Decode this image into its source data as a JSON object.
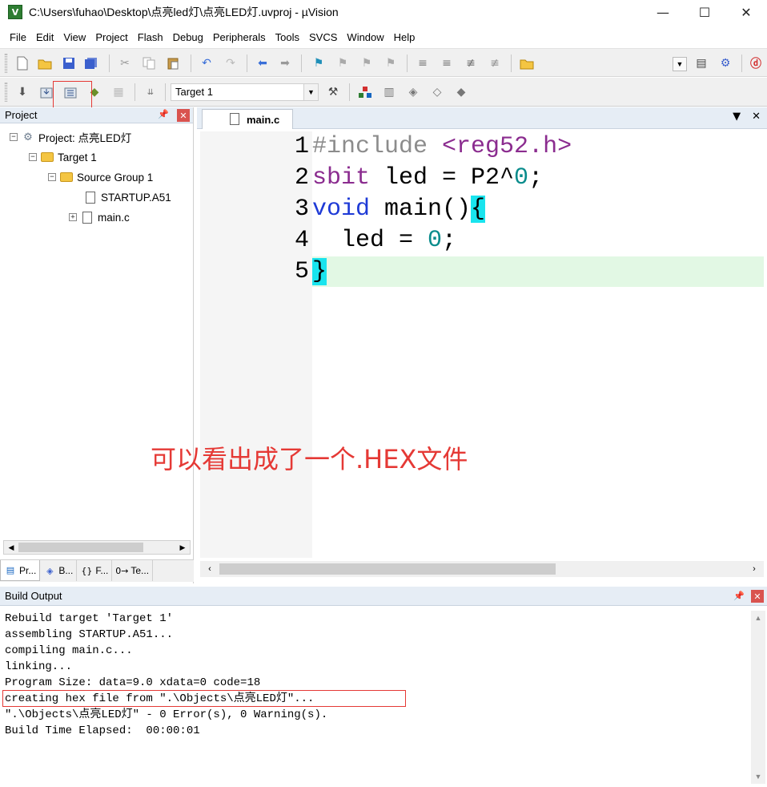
{
  "window": {
    "title": "C:\\Users\\fuhao\\Desktop\\点亮led灯\\点亮LED灯.uvproj - µVision",
    "app_icon_letter": "V",
    "minimize": "—",
    "maximize": "☐",
    "close": "✕"
  },
  "menu": [
    "File",
    "Edit",
    "View",
    "Project",
    "Flash",
    "Debug",
    "Peripherals",
    "Tools",
    "SVCS",
    "Window",
    "Help"
  ],
  "toolbar2": {
    "target": "Target 1"
  },
  "project_panel": {
    "title": "Project",
    "tree": {
      "project": "Project: 点亮LED灯",
      "target": "Target 1",
      "group": "Source Group 1",
      "files": [
        "STARTUP.A51",
        "main.c"
      ]
    },
    "tabs": [
      "Pr...",
      "B...",
      "F...",
      "Te..."
    ]
  },
  "editor": {
    "tab": "main.c",
    "line_numbers": [
      "1",
      "2",
      "3",
      "4",
      "5"
    ],
    "lines": {
      "l1_pp": "#include",
      "l1_str": "<reg52.h>",
      "l2_kw": "sbit",
      "l2_rest": " led = P2^",
      "l2_num": "0",
      "l2_end": ";",
      "l3_kw": "void",
      "l3_rest": " main()",
      "l3_brace": "{",
      "l4_rest": "  led = ",
      "l4_num": "0",
      "l4_end": ";",
      "l5_brace": "}"
    }
  },
  "annotation": "可以看出成了一个.HEX文件",
  "build_output": {
    "title": "Build Output",
    "lines": [
      "Rebuild target 'Target 1'",
      "assembling STARTUP.A51...",
      "compiling main.c...",
      "linking...",
      "Program Size: data=9.0 xdata=0 code=18",
      "creating hex file from \".\\Objects\\点亮LED灯\"...",
      "\".\\Objects\\点亮LED灯\" - 0 Error(s), 0 Warning(s).",
      "Build Time Elapsed:  00:00:01"
    ]
  },
  "colors": {
    "keyword": "#1e3ad6",
    "preprocessor": "#8c8c8c",
    "string": "#8b2c8f",
    "number": "#0a8c8c",
    "brace_highlight": "#19e4ee",
    "current_line": "#e2f8e4",
    "annotation": "#e53935"
  }
}
